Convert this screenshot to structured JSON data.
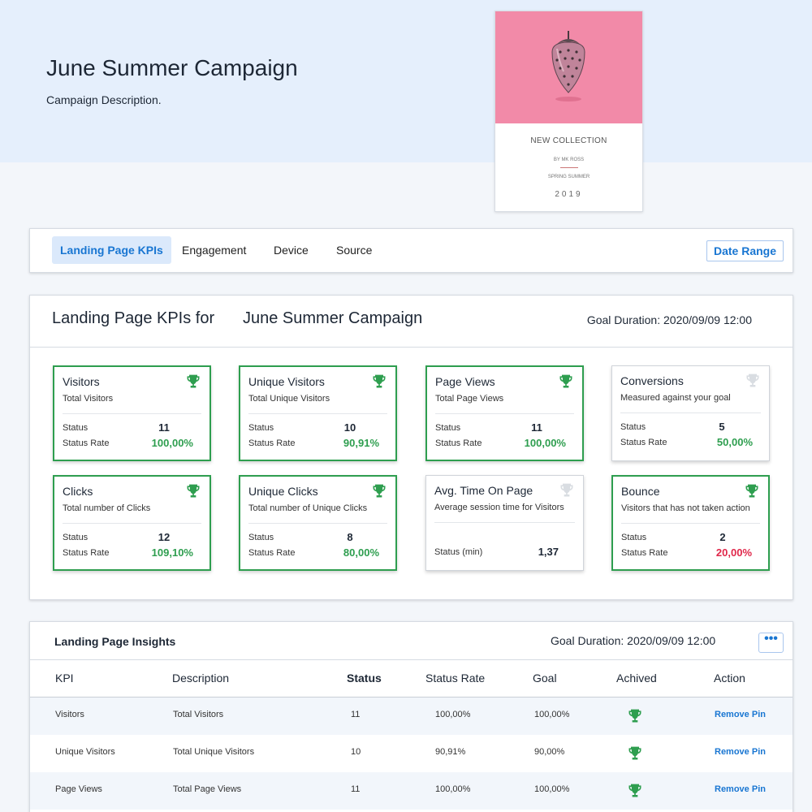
{
  "header": {
    "title": "June Summer Campaign",
    "description": "Campaign Description."
  },
  "cover": {
    "line1": "NEW COLLECTION",
    "line2": "BY MK ROSS",
    "line3": "SPRING SUMMER",
    "line4": "2019",
    "background_color": "#f28aa8"
  },
  "tabs": {
    "items": [
      "Landing Page KPIs",
      "Engagement",
      "Device",
      "Source"
    ],
    "active": "Landing Page KPIs",
    "date_range_label": "Date Range"
  },
  "kpi_panel": {
    "title_prefix": "Landing Page KPIs for",
    "campaign_name": "June Summer Campaign",
    "goal_duration": "Goal Duration: 2020/09/09 12:00",
    "cards": [
      {
        "title": "Visitors",
        "sub": "Total Visitors",
        "label1": "Status",
        "value1": "11",
        "label2": "Status Rate",
        "value2": "100,00%",
        "achieved": true
      },
      {
        "title": "Unique Visitors",
        "sub": "Total Unique Visitors",
        "label1": "Status",
        "value1": "10",
        "label2": "Status Rate",
        "value2": "90,91%",
        "achieved": true
      },
      {
        "title": "Page Views",
        "sub": "Total Page Views",
        "label1": "Status",
        "value1": "11",
        "label2": "Status Rate",
        "value2": "100,00%",
        "achieved": true
      },
      {
        "title": "Conversions",
        "sub": "Measured against your goal",
        "label1": "Status",
        "value1": "5",
        "label2": "Status Rate",
        "value2": "50,00%",
        "achieved": false
      },
      {
        "title": "Clicks",
        "sub": "Total number of Clicks",
        "label1": "Status",
        "value1": "12",
        "label2": "Status Rate",
        "value2": "109,10%",
        "achieved": true
      },
      {
        "title": "Unique Clicks",
        "sub": "Total number of Unique Clicks",
        "label1": "Status",
        "value1": "8",
        "label2": "Status Rate",
        "value2": "80,00%",
        "achieved": true
      },
      {
        "title": "Avg. Time On Page",
        "sub": "Average session time for Visitors",
        "label1": "",
        "value1": "",
        "label2": "Status (min)",
        "value2": "1,37",
        "achieved": false
      },
      {
        "title": "Bounce",
        "sub": "Visitors that has not taken action",
        "label1": "Status",
        "value1": "2",
        "label2": "Status Rate",
        "value2": "20,00%",
        "achieved": true
      }
    ]
  },
  "insights": {
    "title": "Landing Page Insights",
    "goal_duration": "Goal Duration: 2020/09/09 12:00",
    "more_label": "•••",
    "columns": [
      "KPI",
      "Description",
      "Status",
      "Status Rate",
      "Goal",
      "Achived",
      "Action"
    ],
    "rows": [
      {
        "kpi": "Visitors",
        "description": "Total Visitors",
        "status": "11",
        "rate": "100,00%",
        "goal": "100,00%",
        "action": "Remove Pin"
      },
      {
        "kpi": "Unique Visitors",
        "description": "Total Unique Visitors",
        "status": "10",
        "rate": "90,91%",
        "goal": "90,00%",
        "action": "Remove Pin"
      },
      {
        "kpi": "Page Views",
        "description": "Total Page Views",
        "status": "11",
        "rate": "100,00%",
        "goal": "100,00%",
        "action": "Remove Pin"
      }
    ]
  },
  "colors": {
    "accent": "#1976d2",
    "success": "#2e9e4f",
    "danger": "#e0274a",
    "trophy_inactive": "#d9dde2"
  }
}
